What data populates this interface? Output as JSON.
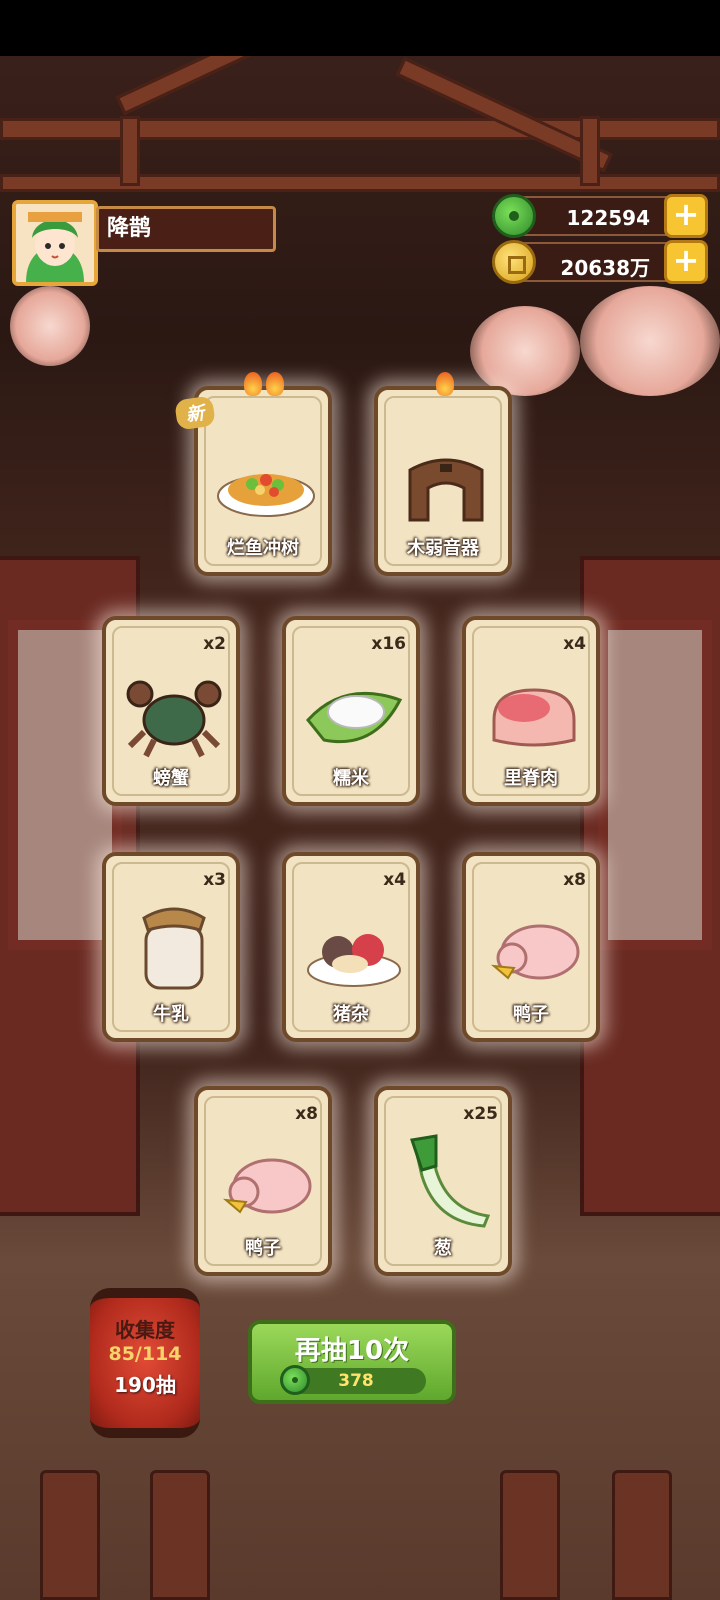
{
  "player": {
    "name": "降鹊"
  },
  "currency": {
    "jade": "122594",
    "coins": "20638万"
  },
  "cards": [
    {
      "name": "烂鱼冲树",
      "count": "",
      "new": true,
      "flames": 2,
      "icon": "fish-dish-icon"
    },
    {
      "name": "木弱音器",
      "count": "",
      "new": false,
      "flames": 1,
      "icon": "wooden-mute-icon"
    },
    {
      "name": "螃蟹",
      "count": "x2",
      "icon": "crab-icon"
    },
    {
      "name": "糯米",
      "count": "x16",
      "icon": "rice-icon"
    },
    {
      "name": "里脊肉",
      "count": "x4",
      "icon": "tenderloin-icon"
    },
    {
      "name": "牛乳",
      "count": "x3",
      "icon": "milk-jar-icon"
    },
    {
      "name": "猪杂",
      "count": "x4",
      "icon": "pork-offal-icon"
    },
    {
      "name": "鸭子",
      "count": "x8",
      "icon": "duck-icon"
    },
    {
      "name": "鸭子",
      "count": "x8",
      "icon": "duck-icon"
    },
    {
      "name": "葱",
      "count": "x25",
      "icon": "scallion-icon"
    }
  ],
  "new_badge": "新",
  "collection": {
    "title": "收集度",
    "progress": "85/114",
    "draws": "190抽"
  },
  "draw_button": {
    "label": "再抽10次",
    "cost": "378"
  },
  "colors": {
    "card_bg": "#f2e4c3",
    "card_border": "#6e4a2a",
    "button_green": "#6fb536",
    "lantern_red": "#c2331f",
    "gold": "#f6c531"
  }
}
